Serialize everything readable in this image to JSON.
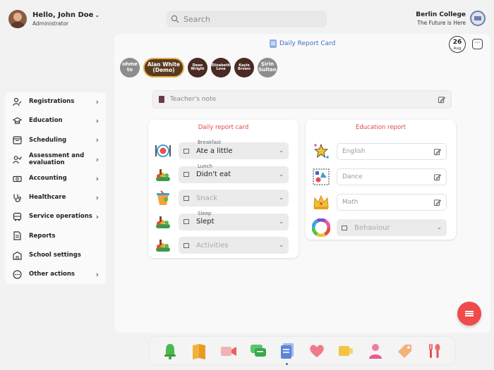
{
  "header": {
    "greeting": "Hello, John Doe",
    "role": "Administrator",
    "search_placeholder": "Search",
    "college_name": "Berlin College",
    "college_slogan": "The Future is Here"
  },
  "sidebar": {
    "items": [
      {
        "label": "Registrations",
        "icon": "registration-icon",
        "arrow": true
      },
      {
        "label": "Education",
        "icon": "education-icon",
        "arrow": true
      },
      {
        "label": "Scheduling",
        "icon": "calendar-icon",
        "arrow": true
      },
      {
        "label": "Assessment and evaluation",
        "icon": "assessment-icon",
        "arrow": true
      },
      {
        "label": "Accounting",
        "icon": "money-icon",
        "arrow": true
      },
      {
        "label": "Healthcare",
        "icon": "stethoscope-icon",
        "arrow": true
      },
      {
        "label": "Service operations",
        "icon": "bus-icon",
        "arrow": true
      },
      {
        "label": "Reports",
        "icon": "report-icon",
        "arrow": false
      },
      {
        "label": "School settings",
        "icon": "school-icon",
        "arrow": false
      },
      {
        "label": "Other actions",
        "icon": "more-actions-icon",
        "arrow": true
      }
    ]
  },
  "main": {
    "title": "Daily Report Card",
    "date_day": "26",
    "date_month": "Aug",
    "more_label": "···",
    "students": [
      {
        "label": "ohme to",
        "style": "gray"
      },
      {
        "label": "Alan White (Demo)",
        "style": "sel"
      },
      {
        "label": "Dean Wright",
        "style": "dark"
      },
      {
        "label": "Elizabeth Love",
        "style": "dark"
      },
      {
        "label": "Kayle Brown",
        "style": "dark"
      },
      {
        "label": "Şirin Sultan",
        "style": "gray"
      }
    ],
    "teacher_note_placeholder": "Teacher's note"
  },
  "daily_report": {
    "title": "Daily report card",
    "rows": [
      {
        "small": "Breakfast",
        "value": "Ate a little",
        "placeholder": false
      },
      {
        "small": "Lunch",
        "value": "Didn't eat",
        "placeholder": false
      },
      {
        "small": "",
        "value": "Snack",
        "placeholder": true
      },
      {
        "small": "Sleep",
        "value": "Slept",
        "placeholder": false
      },
      {
        "small": "",
        "value": "Activities",
        "placeholder": true
      }
    ]
  },
  "education_report": {
    "title": "Education report",
    "fields": [
      {
        "placeholder": "English"
      },
      {
        "placeholder": "Dance"
      },
      {
        "placeholder": "Math"
      }
    ],
    "behaviour_label": "Behaviour"
  },
  "dock": {
    "items": [
      "bell-icon",
      "book-icon",
      "video-icon",
      "chat-icon",
      "daily-report-icon",
      "heart-icon",
      "media-icon",
      "person-icon",
      "tag-icon",
      "food-icon"
    ]
  },
  "colors": {
    "accent_red": "#ef4b4b",
    "accent_blue": "#3f6fc9",
    "card_title": "#e04848"
  }
}
